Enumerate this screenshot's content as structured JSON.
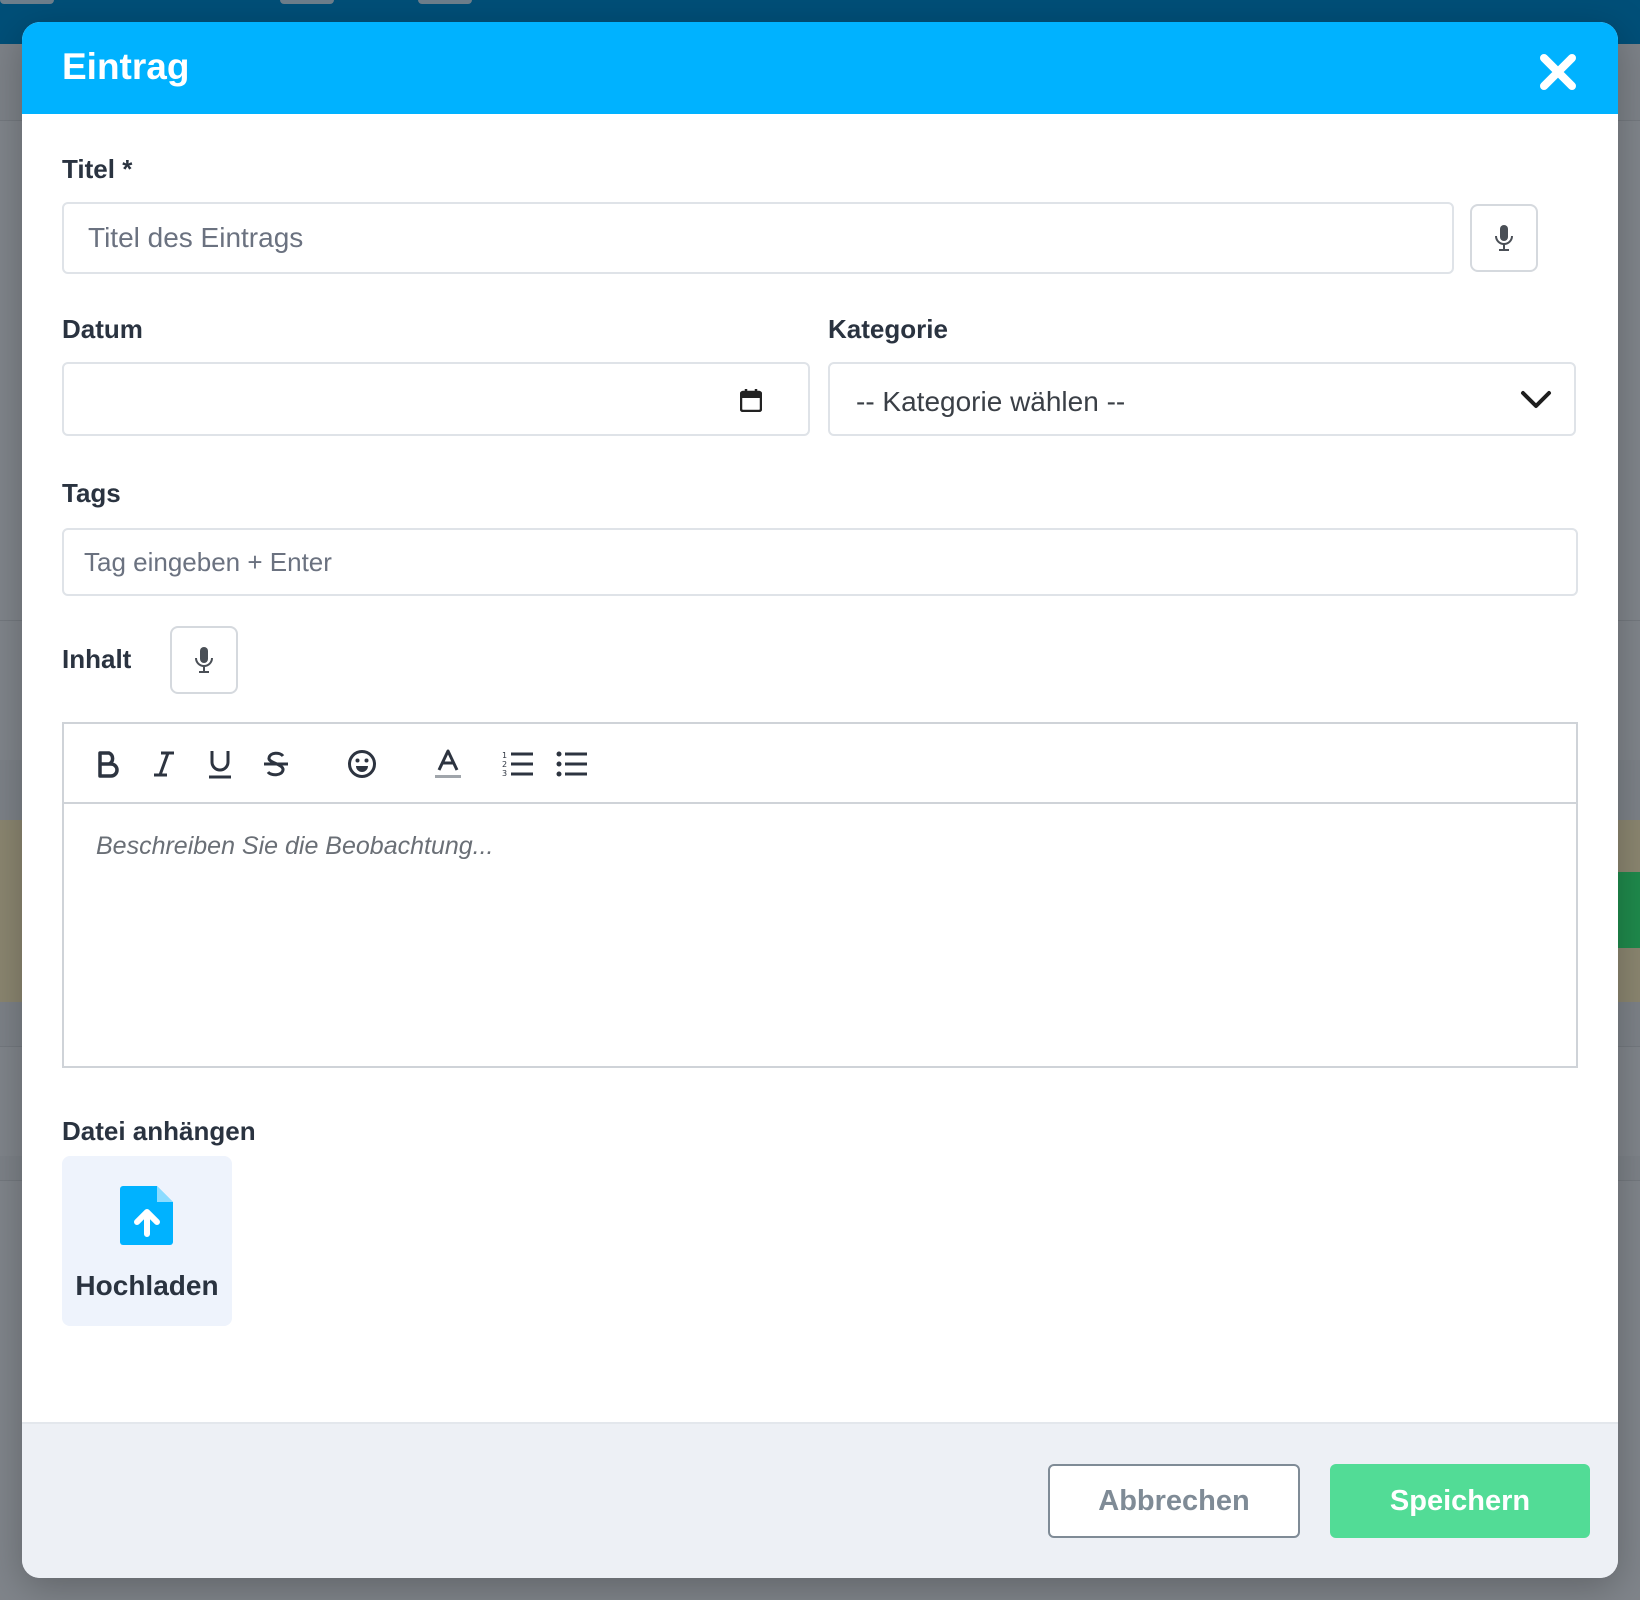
{
  "modal": {
    "title": "Eintrag"
  },
  "form": {
    "title_label": "Titel *",
    "title_placeholder": "Titel des Eintrags",
    "date_label": "Datum",
    "category_label": "Kategorie",
    "category_selected": "-- Kategorie wählen --",
    "tags_label": "Tags",
    "tags_placeholder": "Tag eingeben + Enter",
    "content_label": "Inhalt",
    "content_placeholder": "Beschreiben Sie die Beobachtung...",
    "attach_label": "Datei anhängen",
    "upload_label": "Hochladen"
  },
  "toolbar": {
    "items": [
      "bold-icon",
      "italic-icon",
      "underline-icon",
      "strikethrough-icon",
      "emoji-icon",
      "text-color-icon",
      "ordered-list-icon",
      "bullet-list-icon"
    ]
  },
  "footer": {
    "cancel_label": "Abbrechen",
    "save_label": "Speichern"
  },
  "colors": {
    "header": "#00b2ff",
    "save": "#52dc96",
    "upload_icon": "#00b2ff"
  }
}
